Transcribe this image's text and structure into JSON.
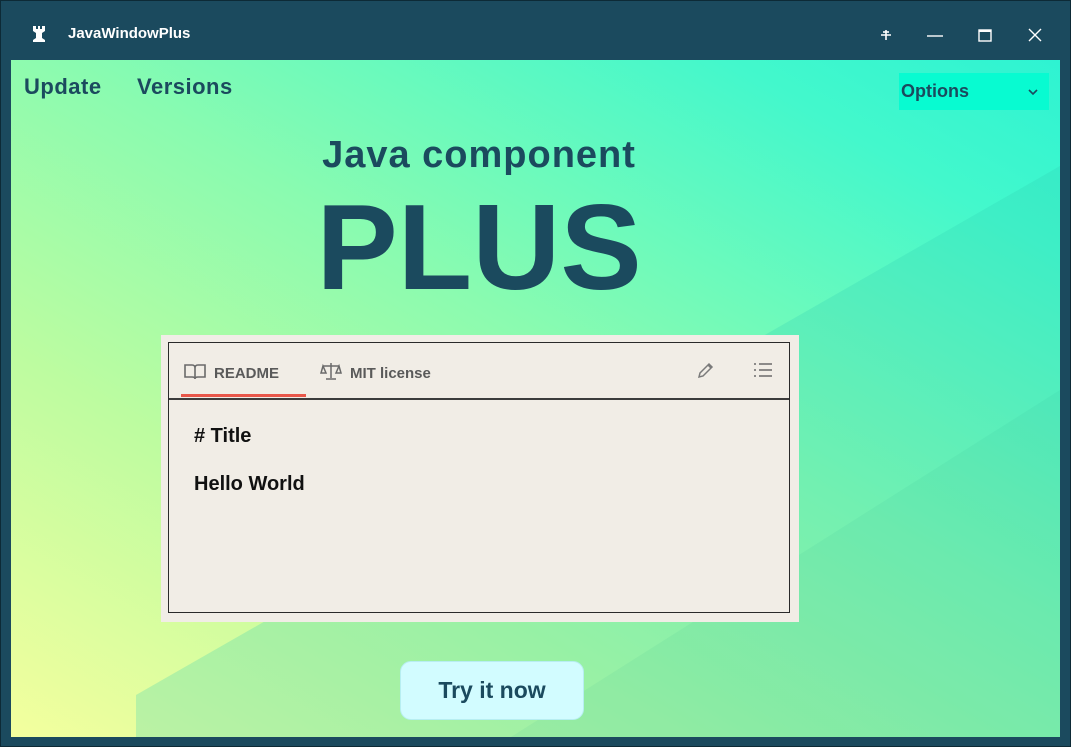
{
  "window": {
    "title": "JavaWindowPlus",
    "app_icon": "chess-rook-icon",
    "controls": [
      "pin-icon",
      "minimize-icon",
      "maximize-icon",
      "close-icon"
    ]
  },
  "nav": {
    "links": [
      "Update",
      "Versions"
    ],
    "options": {
      "label": "Options",
      "icon": "chevron-down-icon"
    }
  },
  "hero": {
    "subtitle": "Java component",
    "title": "PLUS"
  },
  "card": {
    "tabs": [
      {
        "label": "README",
        "icon": "book-icon",
        "active": true
      },
      {
        "label": "MIT license",
        "icon": "scale-icon",
        "active": false
      }
    ],
    "tools": [
      "pencil-icon",
      "list-icon"
    ],
    "content": [
      "# Title",
      "Hello World"
    ]
  },
  "cta": {
    "label": "Try it now"
  },
  "colors": {
    "primary": "#1b4a5e",
    "options_bg": "#08fbd1",
    "cta_bg": "#d2fcff",
    "tab_accent": "#e8574a",
    "card_bg": "#f1ede6"
  }
}
